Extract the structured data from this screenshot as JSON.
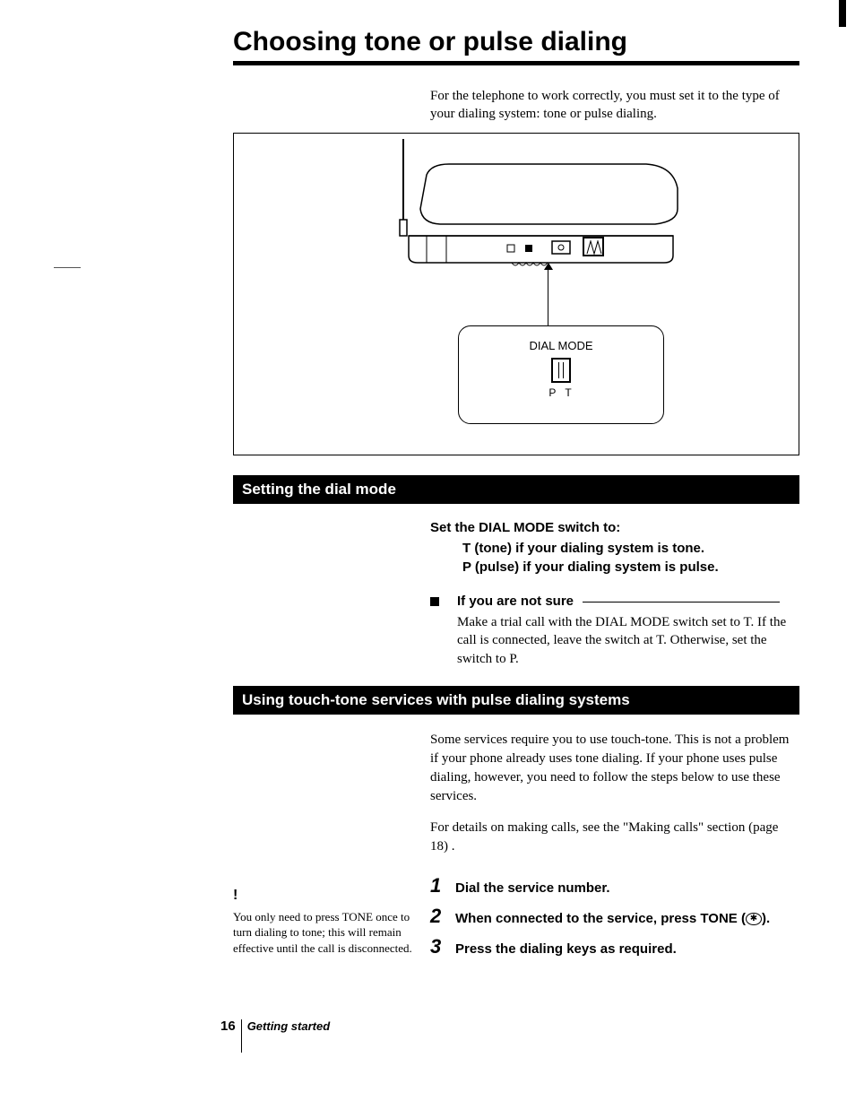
{
  "title": "Choosing tone or pulse dialing",
  "intro": "For the telephone to work correctly, you must set it to the type of your dialing system: tone or pulse dialing.",
  "diagram": {
    "label": "DIAL MODE",
    "p": "P",
    "t": "T"
  },
  "section1": {
    "bar": "Setting the dial mode",
    "set_heading": "Set the DIAL MODE switch to:",
    "line_t": "T (tone)  if your dialing system is tone.",
    "line_p": "P (pulse)  if your dialing system is pulse.",
    "notsure_title": "If you are not sure",
    "notsure_body": "Make a trial call with the DIAL MODE switch set to T. If the call is connected, leave the switch at T. Otherwise, set the switch to P."
  },
  "section2": {
    "bar": "Using touch-tone services with pulse dialing systems",
    "para1": "Some services require you to use touch-tone. This is not a problem if your phone already uses tone dialing. If your phone uses pulse dialing, however, you need to follow the steps below to use these services.",
    "para2": "For details on making calls, see the \"Making calls\" section (page 18) .",
    "steps": [
      {
        "n": "1",
        "t": "Dial the service number."
      },
      {
        "n": "2",
        "t": "When connected to the service, press TONE (",
        "suffix": ")."
      },
      {
        "n": "3",
        "t": "Press the dialing keys as required."
      }
    ]
  },
  "sidenote": {
    "mark": "!",
    "text": "You only need to press TONE once to turn dialing to tone; this will remain effective until the call is disconnected."
  },
  "footer": {
    "page": "16",
    "section": "Getting started"
  }
}
